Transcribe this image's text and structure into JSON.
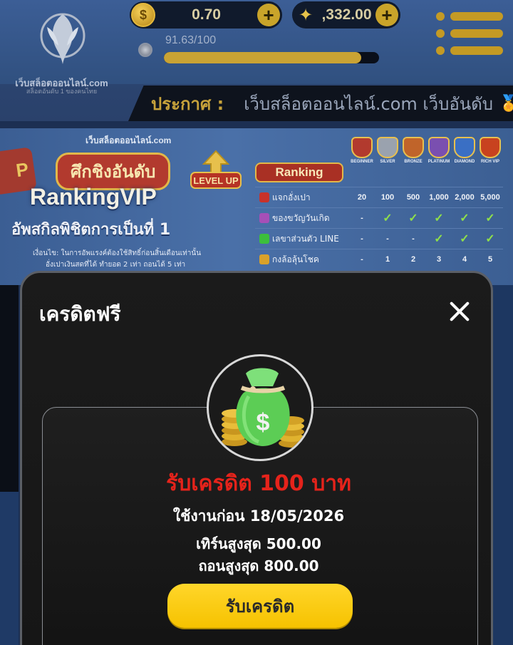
{
  "header": {
    "logo_title": "เว็บสล็อตออนไลน์.com",
    "logo_subtitle": "สล็อตอันดับ 1 ของคนไทย",
    "balance": "0.70",
    "points": ",332.00",
    "plus_symbol": "+",
    "coin_symbol": "$",
    "progress_label": "91.63/100",
    "progress_fraction": 0.9163,
    "accent_color": "#c9a334"
  },
  "announcement": {
    "label": "ประกาศ :",
    "text": "เว็บสล็อตออนไลน์.com เว็บอันดับ",
    "medal_icon": "medal-icon"
  },
  "banner": {
    "left_tag": "P",
    "site": "เว็บสล็อตออนไลน์.com",
    "headline": "ศึกชิงอันดับ",
    "level_up": "LEVEL UP",
    "big_title": "RankingVIP",
    "subtitle": "อัพสกิลพิชิตการเป็นที่ 1",
    "condition_1": "เงื่อนไข: ในการอัพแรงค์ต้องใช้สิทธิ์ก่อนสิ้นเดือนเท่านั้น",
    "condition_2": "อั่งเปาเงินสดที่ได้ ทำยอด 2 เท่า ถอนได้ 5 เท่า"
  },
  "ranking": {
    "title": "Ranking",
    "tiers": [
      {
        "name": "BEGINNER",
        "color": "#b23a2e"
      },
      {
        "name": "SILVER",
        "color": "#9aa2ae"
      },
      {
        "name": "BRONZE",
        "color": "#c0642a"
      },
      {
        "name": "PLATINUM",
        "color": "#7a4fb0"
      },
      {
        "name": "DIAMOND",
        "color": "#3a6fc4"
      },
      {
        "name": "RICH VIP",
        "color": "#c8421f"
      }
    ],
    "rows": [
      {
        "label": "แจกอั่งเปา",
        "icon_color": "#c8322a",
        "cells": [
          "20",
          "100",
          "500",
          "1,000",
          "2,000",
          "5,000"
        ]
      },
      {
        "label": "ของขวัญวันเกิด",
        "icon_color": "#a64fb7",
        "cells": [
          "-",
          "✓",
          "✓",
          "✓",
          "✓",
          "✓"
        ]
      },
      {
        "label": "เลขาส่วนตัว LINE",
        "icon_color": "#3cbf3c",
        "cells": [
          "-",
          "-",
          "-",
          "✓",
          "✓",
          "✓"
        ]
      },
      {
        "label": "กงล้อลุ้นโชค",
        "icon_color": "#d8a12a",
        "cells": [
          "-",
          "1",
          "2",
          "3",
          "4",
          "5"
        ]
      }
    ]
  },
  "modal": {
    "title": "เครดิตฟรี",
    "reward_title": "รับเครดิต 100 บาท",
    "expire": "ใช้งานก่อน 18/05/2026",
    "turnover": "เทิร์นสูงสุด 500.00",
    "withdraw": "ถอนสูงสุด 800.00",
    "claim_button": "รับเครดิต",
    "reward_color": "#e5231b",
    "button_color": "#ffd62a"
  }
}
